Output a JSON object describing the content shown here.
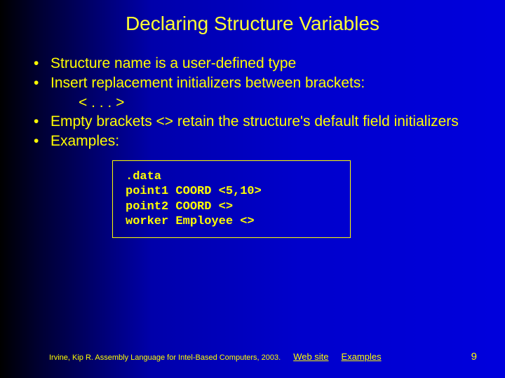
{
  "title": "Declaring Structure Variables",
  "bullets": {
    "b0": "Structure name is a user-defined type",
    "b1": "Insert replacement initializers between brackets:",
    "b1_sub": "< . . . >",
    "b2": "Empty brackets <> retain the structure's default field initializers",
    "b3": "Examples:"
  },
  "code": ".data\npoint1 COORD <5,10>\npoint2 COORD <>\nworker Employee <>",
  "footer": {
    "citation": "Irvine, Kip R. Assembly Language for Intel-Based Computers, 2003.",
    "link_web": "Web site",
    "link_examples": "Examples"
  },
  "slide_number": "9"
}
